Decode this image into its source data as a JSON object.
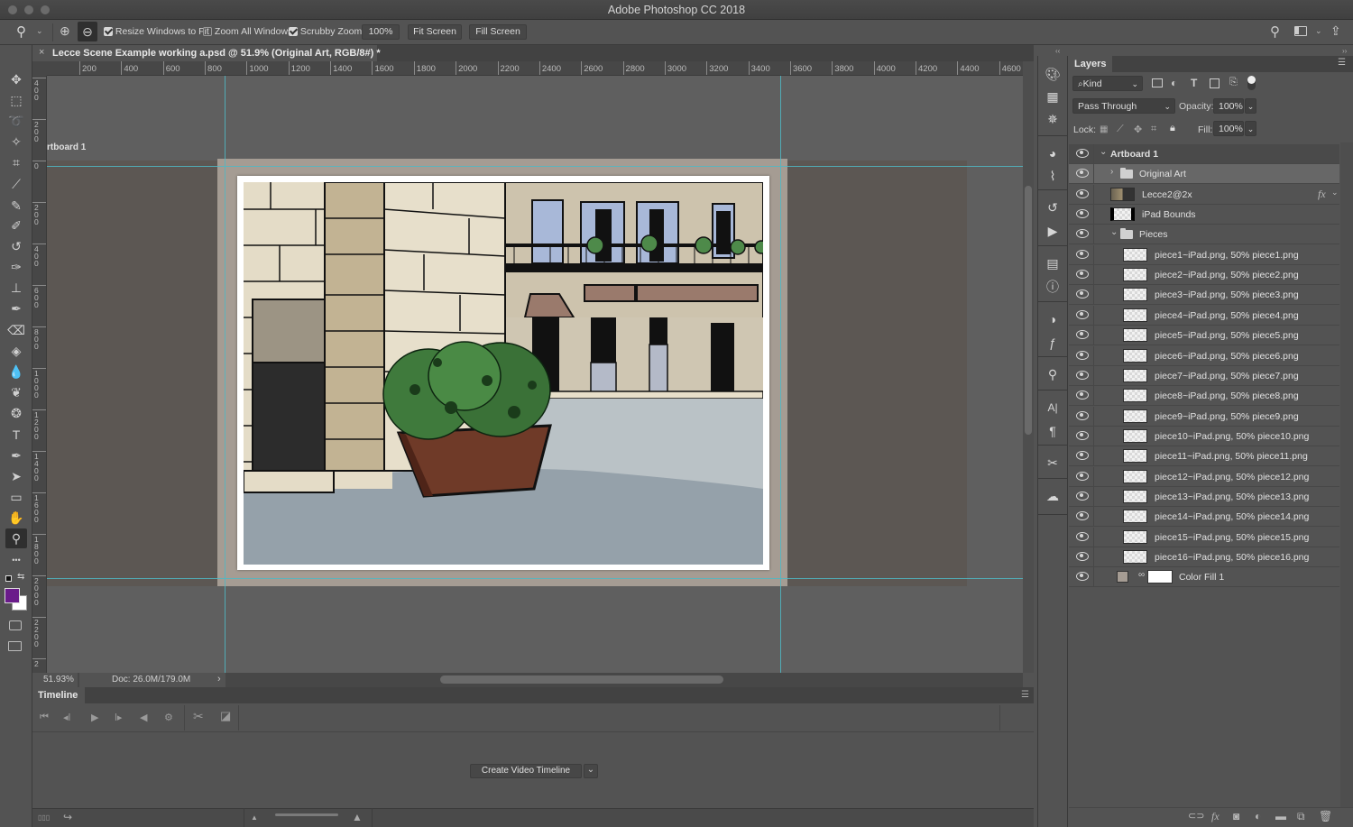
{
  "window": {
    "title": "Adobe Photoshop CC 2018"
  },
  "options_bar": {
    "tool_icon": "zoom-icon",
    "zoom_in_icon": "zoom-in-icon",
    "zoom_out_icon": "zoom-out-icon",
    "resize_windows": {
      "label": "Resize Windows to Fit",
      "checked": true
    },
    "zoom_all_windows": {
      "label": "Zoom All Windows",
      "checked": false
    },
    "scrubby_zoom": {
      "label": "Scrubby Zoom",
      "checked": true
    },
    "zoom_value": "100%",
    "fit_screen": "Fit Screen",
    "fill_screen": "Fill Screen",
    "right_icons": [
      "search-icon",
      "workspace-icon",
      "share-icon"
    ]
  },
  "document_tab": {
    "close": "×",
    "title": "Lecce Scene Example working a.psd @ 51.9% (Original Art, RGB/8#) *"
  },
  "rulers": {
    "horizontal": [
      "200",
      "400",
      "600",
      "800",
      "1000",
      "1200",
      "1400",
      "1600",
      "1800",
      "2000",
      "2200",
      "2400",
      "2600",
      "2800",
      "3000",
      "3200",
      "3400",
      "3600",
      "3800",
      "4000",
      "4200",
      "4400",
      "4600"
    ],
    "vertical": [
      "400",
      "200",
      "0",
      "200",
      "400",
      "600",
      "800",
      "1000",
      "1200",
      "1400",
      "1600",
      "1800",
      "2000",
      "2200",
      "2"
    ]
  },
  "canvas": {
    "artboard_label": "rtboard 1",
    "guide_color": "#4fb8c4"
  },
  "tools": [
    {
      "name": "move-tool",
      "glyph": "✥"
    },
    {
      "name": "marquee-tool",
      "glyph": "⬚"
    },
    {
      "name": "lasso-tool",
      "glyph": "➰"
    },
    {
      "name": "magic-wand-tool",
      "glyph": "✧"
    },
    {
      "name": "crop-tool",
      "glyph": "⌗"
    },
    {
      "name": "eyedropper-tool",
      "glyph": "⟋"
    },
    {
      "name": "brush-tool",
      "glyph": "✎"
    },
    {
      "name": "pencil-tool",
      "glyph": "✐"
    },
    {
      "name": "history-brush-tool",
      "glyph": "↺"
    },
    {
      "name": "mixer-brush-tool",
      "glyph": "✑"
    },
    {
      "name": "clone-stamp-tool",
      "glyph": "⊥"
    },
    {
      "name": "art-history-brush-tool",
      "glyph": "✒"
    },
    {
      "name": "eraser-tool",
      "glyph": "⌫"
    },
    {
      "name": "paint-bucket-tool",
      "glyph": "◈"
    },
    {
      "name": "blur-tool",
      "glyph": "💧"
    },
    {
      "name": "dodge-tool",
      "glyph": "❦"
    },
    {
      "name": "sponge-tool",
      "glyph": "❂"
    },
    {
      "name": "type-tool",
      "glyph": "T"
    },
    {
      "name": "pen-tool",
      "glyph": "✒"
    },
    {
      "name": "path-selection-tool",
      "glyph": "➤"
    },
    {
      "name": "rectangle-tool",
      "glyph": "▭"
    },
    {
      "name": "hand-tool",
      "glyph": "✋"
    },
    {
      "name": "zoom-tool",
      "glyph": "⚲"
    },
    {
      "name": "more-tools",
      "glyph": "•••"
    }
  ],
  "colors": {
    "foreground": "#6a1b8a",
    "background": "#ffffff"
  },
  "status_bar": {
    "zoom": "51.93%",
    "doc": "Doc: 26.0M/179.0M",
    "arrow": "›"
  },
  "timeline": {
    "tab": "Timeline",
    "create_button": "Create Video Timeline",
    "dropdown_glyph": "⌄",
    "controls": [
      "first-frame-icon",
      "prev-frame-icon",
      "play-icon",
      "next-frame-icon",
      "audio-icon",
      "settings-icon",
      "split-icon",
      "transition-icon"
    ]
  },
  "dock": {
    "icons": [
      "color-swatches-icon",
      "grid-icon",
      "navigator-icon",
      "channels-icon",
      "paths-icon",
      "history-icon",
      "actions-icon",
      "properties-icon",
      "info-icon",
      "adjustments-icon",
      "styles-icon",
      "clone-source-icon",
      "character-icon",
      "paragraph-icon",
      "tool-presets-icon",
      "libraries-icon"
    ]
  },
  "layers_panel": {
    "tab": "Layers",
    "filter_kind": "Kind",
    "blend_mode": "Pass Through",
    "opacity_label": "Opacity:",
    "opacity": "100%",
    "lock_label": "Lock:",
    "fill_label": "Fill:",
    "fill": "100%",
    "layers": [
      {
        "name": "Artboard 1",
        "type": "artboard",
        "indent": 0,
        "expanded": true,
        "visible": true
      },
      {
        "name": "Original Art",
        "type": "group",
        "indent": 1,
        "expanded": false,
        "visible": true,
        "selected": true
      },
      {
        "name": "Lecce2@2x",
        "type": "smart",
        "indent": 1,
        "visible": true,
        "fx": "fx"
      },
      {
        "name": "iPad Bounds",
        "type": "pixel",
        "indent": 1,
        "visible": true
      },
      {
        "name": "Pieces",
        "type": "group",
        "indent": 1,
        "expanded": true,
        "visible": true
      },
      {
        "name": "piece1~iPad.png, 50% piece1.png",
        "type": "pixel",
        "indent": 2,
        "visible": true
      },
      {
        "name": "piece2~iPad.png, 50% piece2.png",
        "type": "pixel",
        "indent": 2,
        "visible": true
      },
      {
        "name": "piece3~iPad.png, 50% piece3.png",
        "type": "pixel",
        "indent": 2,
        "visible": true
      },
      {
        "name": "piece4~iPad.png, 50% piece4.png",
        "type": "pixel",
        "indent": 2,
        "visible": true
      },
      {
        "name": "piece5~iPad.png, 50% piece5.png",
        "type": "pixel",
        "indent": 2,
        "visible": true
      },
      {
        "name": "piece6~iPad.png, 50% piece6.png",
        "type": "pixel",
        "indent": 2,
        "visible": true
      },
      {
        "name": "piece7~iPad.png, 50% piece7.png",
        "type": "pixel",
        "indent": 2,
        "visible": true
      },
      {
        "name": "piece8~iPad.png, 50% piece8.png",
        "type": "pixel",
        "indent": 2,
        "visible": true
      },
      {
        "name": "piece9~iPad.png, 50% piece9.png",
        "type": "pixel",
        "indent": 2,
        "visible": true
      },
      {
        "name": "piece10~iPad.png, 50% piece10.png",
        "type": "pixel",
        "indent": 2,
        "visible": true
      },
      {
        "name": "piece11~iPad.png, 50% piece11.png",
        "type": "pixel",
        "indent": 2,
        "visible": true
      },
      {
        "name": "piece12~iPad.png, 50% piece12.png",
        "type": "pixel",
        "indent": 2,
        "visible": true
      },
      {
        "name": "piece13~iPad.png, 50% piece13.png",
        "type": "pixel",
        "indent": 2,
        "visible": true
      },
      {
        "name": "piece14~iPad.png, 50% piece14.png",
        "type": "pixel",
        "indent": 2,
        "visible": true
      },
      {
        "name": "piece15~iPad.png, 50% piece15.png",
        "type": "pixel",
        "indent": 2,
        "visible": true
      },
      {
        "name": "piece16~iPad.png, 50% piece16.png",
        "type": "pixel",
        "indent": 2,
        "visible": true
      },
      {
        "name": "Color Fill 1",
        "type": "fill",
        "indent": 1,
        "visible": true,
        "fill_color": "#a59c93"
      }
    ],
    "footer_icons": [
      "link-icon",
      "fx-icon",
      "mask-icon",
      "adjustment-icon",
      "new-group-icon",
      "new-layer-icon",
      "trash-icon"
    ]
  }
}
